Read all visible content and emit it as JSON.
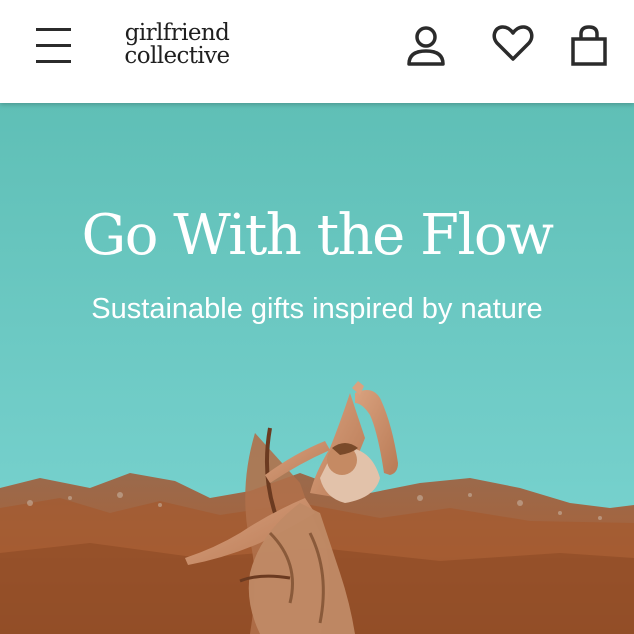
{
  "header": {
    "logo_line1": "girlfriend",
    "logo_line2": "collective",
    "icons": [
      "menu-icon",
      "account-icon",
      "heart-icon",
      "shopping-bag-icon"
    ]
  },
  "hero": {
    "title": "Go With the Flow",
    "subtitle": "Sustainable gifts inspired by nature"
  },
  "colors": {
    "sky_top": "#5fbfb6",
    "sky_bottom": "#7dd6d4",
    "mountain": "#a8623a",
    "text": "#ffffff",
    "icon": "#2b2b2b"
  }
}
